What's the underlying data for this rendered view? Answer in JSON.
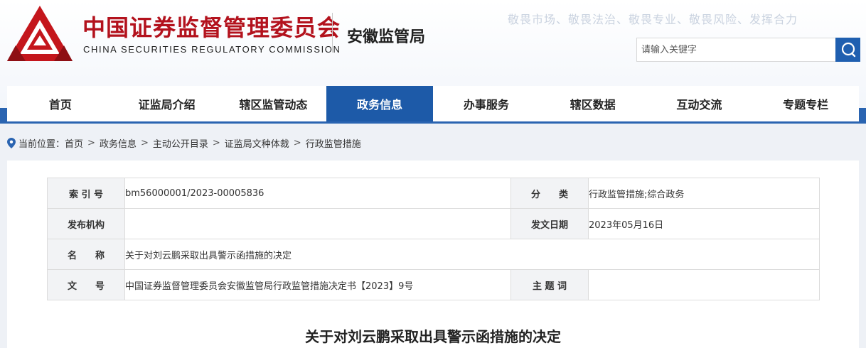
{
  "header": {
    "org_name_cn": "中国证券监督管理委员会",
    "org_name_en": "CHINA SECURITIES REGULATORY COMMISSION",
    "bureau": "安徽监管局",
    "slogan": "敬畏市场、敬畏法治、敬畏专业、敬畏风险、发挥合力",
    "search_placeholder": "请输入关键字",
    "brand_color": "#b3121d",
    "accent_color": "#1d5aa8"
  },
  "nav": {
    "items": [
      "首页",
      "证监局介绍",
      "辖区监管动态",
      "政务信息",
      "办事服务",
      "辖区数据",
      "互动交流",
      "专题专栏"
    ],
    "active": "政务信息"
  },
  "breadcrumb": {
    "prefix": "当前位置：",
    "items": [
      "首页",
      "政务信息",
      "主动公开目录",
      "证监局文种体裁",
      "行政监管措施"
    ]
  },
  "meta": {
    "index_label": "索 引 号",
    "index_value": "bm56000001/2023-00005836",
    "category_label": "分　　类",
    "category_value": "行政监管措施;综合政务",
    "issuer_label": "发布机构",
    "issuer_value": "",
    "date_label": "发文日期",
    "date_value": "2023年05月16日",
    "name_label": "名　　称",
    "name_value": "关于对刘云鹏采取出具警示函措施的决定",
    "doc_no_label": "文　　号",
    "doc_no_value": "中国证券监督管理委员会安徽监管局行政监管措施决定书【2023】9号",
    "keywords_label": "主 题 词",
    "keywords_value": ""
  },
  "document": {
    "title": "关于对刘云鹏采取出具警示函措施的决定"
  }
}
